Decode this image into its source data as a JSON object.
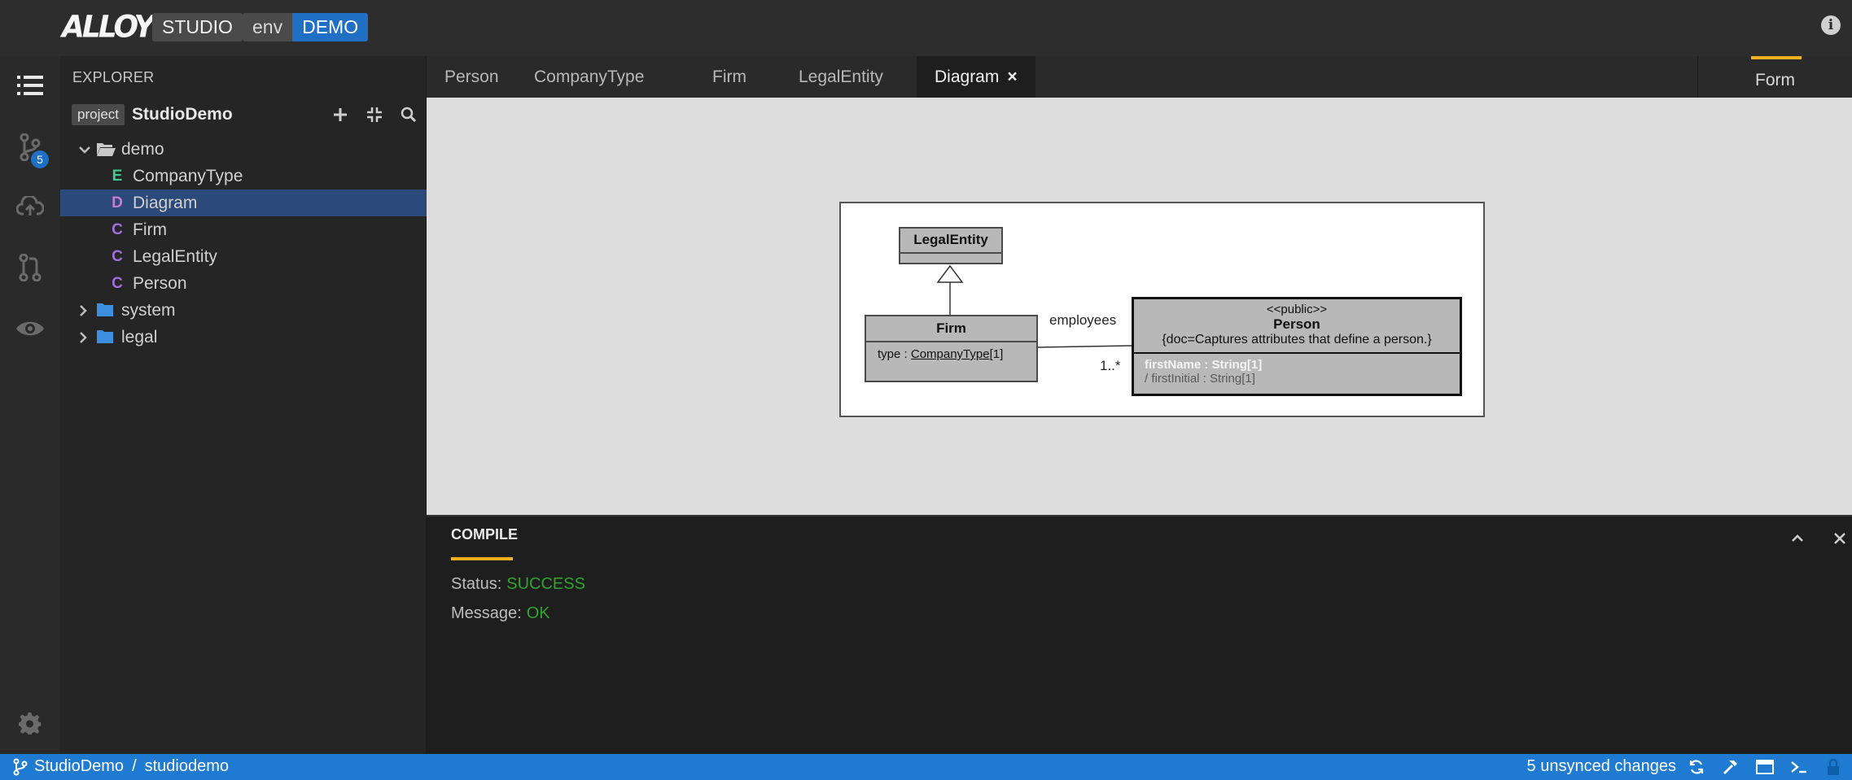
{
  "header": {
    "logo_text": "ALLOY",
    "app_name": "STUDIO",
    "env_label": "env",
    "env_value": "DEMO"
  },
  "activity_bar": {
    "items": [
      "explorer-icon",
      "source-control-icon",
      "cloud-sync-icon",
      "review-icon",
      "view-icon"
    ],
    "source_control_badge": "5",
    "settings_icon": "gear-icon"
  },
  "explorer": {
    "title": "EXPLORER",
    "project_tag": "project",
    "project_name": "StudioDemo",
    "tree": [
      {
        "label": "demo",
        "kind": "folder-open"
      },
      {
        "label": "CompanyType",
        "kind": "element",
        "letter": "E",
        "letter_color": "#3fcf8e"
      },
      {
        "label": "Diagram",
        "kind": "element",
        "letter": "D",
        "letter_color": "#c77dd1",
        "selected": true
      },
      {
        "label": "Firm",
        "kind": "element",
        "letter": "C",
        "letter_color": "#a36ee0"
      },
      {
        "label": "LegalEntity",
        "kind": "element",
        "letter": "C",
        "letter_color": "#a36ee0"
      },
      {
        "label": "Person",
        "kind": "element",
        "letter": "C",
        "letter_color": "#a36ee0"
      },
      {
        "label": "system",
        "kind": "folder"
      },
      {
        "label": "legal",
        "kind": "folder"
      }
    ]
  },
  "tabs": [
    {
      "label": "Person"
    },
    {
      "label": "CompanyType"
    },
    {
      "label": "Firm"
    },
    {
      "label": "LegalEntity"
    },
    {
      "label": "Diagram",
      "active": true,
      "close": "×"
    }
  ],
  "form_tab": "Form",
  "diagram": {
    "legal_entity": {
      "title": "LegalEntity"
    },
    "firm": {
      "title": "Firm",
      "attr_prefix": "type : ",
      "attr_type": "CompanyType",
      "attr_suffix": "[1]"
    },
    "person": {
      "stereotype": "<<public>>",
      "title": "Person",
      "doc": "{doc=Captures attributes that define a person.}",
      "attr1": "firstName : String[1]",
      "attr2": "/ firstInitial : String[1]"
    },
    "association_label": "employees",
    "multiplicity": "1..*"
  },
  "panel": {
    "tab": "COMPILE",
    "status_label": "Status:",
    "status_value": "SUCCESS",
    "message_label": "Message:",
    "message_value": "OK"
  },
  "statusbar": {
    "workspace": "StudioDemo",
    "separator": "/",
    "branch": "studiodemo",
    "changes": "5 unsynced changes"
  },
  "colors": {
    "accent": "#1f7ad1",
    "tab_underline": "#f2b01e",
    "success": "#2fa52f"
  }
}
